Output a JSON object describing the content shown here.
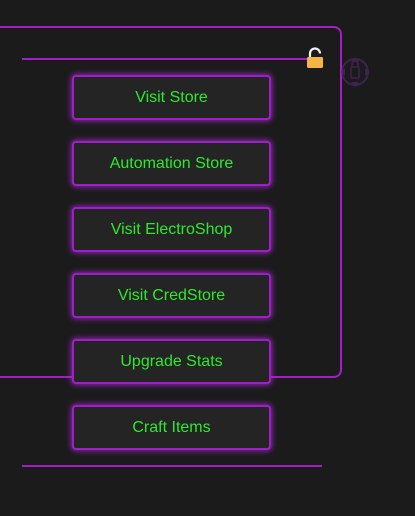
{
  "colors": {
    "background": "#1b1b1b",
    "accent_purple": "#a31ec9",
    "button_text_green": "#2ee82e",
    "button_fill": "#242424",
    "lock_yellow": "#f5b544"
  },
  "icons": {
    "lock": "lock-icon",
    "drag_handle": "drag-handle-icon"
  },
  "menu": {
    "buttons": [
      {
        "label": "Visit Store"
      },
      {
        "label": "Automation Store"
      },
      {
        "label": "Visit ElectroShop"
      },
      {
        "label": "Visit CredStore"
      },
      {
        "label": "Upgrade Stats"
      },
      {
        "label": "Craft Items"
      }
    ]
  }
}
